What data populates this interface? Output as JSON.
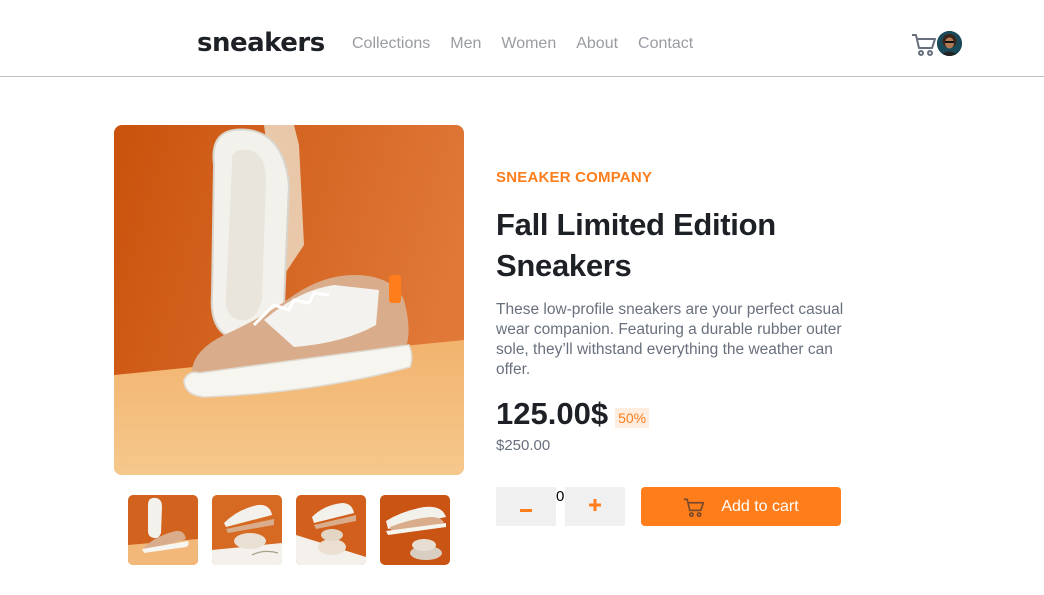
{
  "header": {
    "logo": "sneakers",
    "nav": [
      "Collections",
      "Men",
      "Women",
      "About",
      "Contact"
    ],
    "cart_icon": "cart-icon",
    "avatar_icon": "avatar"
  },
  "gallery": {
    "main_image": "sneaker-sole-up-on-orange",
    "thumbnails": [
      "thumbnail-1",
      "thumbnail-2",
      "thumbnail-3",
      "thumbnail-4"
    ]
  },
  "product": {
    "company": "SNEAKER COMPANY",
    "title": "Fall Limited Edition Sneakers",
    "description": "These low-profile sneakers are your perfect casual wear companion. Featuring a durable rubber outer sole, they’ll withstand everything the weather can offer.",
    "price": "125.00$",
    "discount": "50%",
    "old_price": "$250.00"
  },
  "cart": {
    "quantity": "0",
    "minus_icon": "minus-icon",
    "plus_icon": "plus-icon",
    "add_label": "Add to cart"
  },
  "colors": {
    "accent": "#ff7d1a",
    "accent_pale": "#ffede0",
    "text_dark": "#1d2025",
    "text_grey": "#68707d"
  }
}
